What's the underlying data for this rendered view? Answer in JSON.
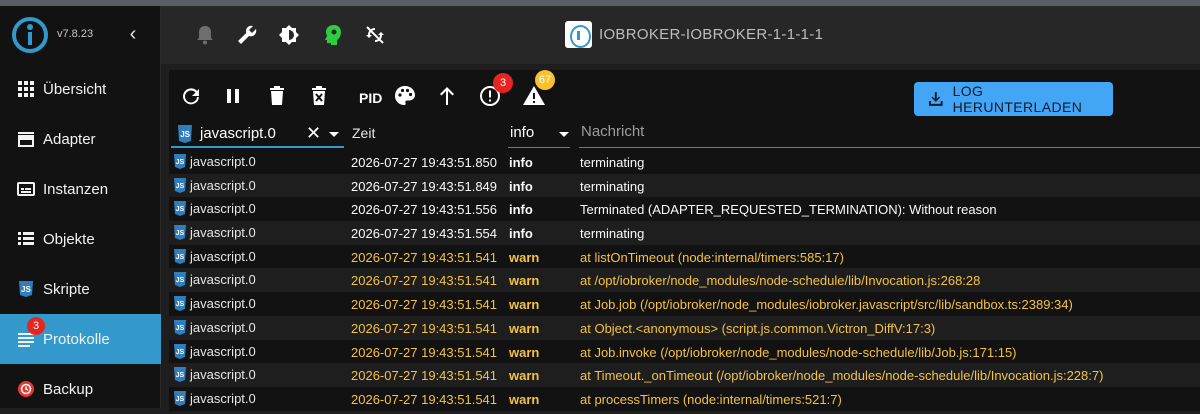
{
  "app": {
    "version": "v7.8.23",
    "host_name": "IOBROKER-IOBROKER-1-1-1-1"
  },
  "sidebar": {
    "items": [
      {
        "label": "Übersicht",
        "icon": "apps-grid-icon"
      },
      {
        "label": "Adapter",
        "icon": "store-icon"
      },
      {
        "label": "Instanzen",
        "icon": "instances-icon"
      },
      {
        "label": "Objekte",
        "icon": "list-icon"
      },
      {
        "label": "Skripte",
        "icon": "javascript-icon"
      },
      {
        "label": "Protokolle",
        "icon": "logs-icon",
        "badge": "3",
        "active": true
      },
      {
        "label": "Backup",
        "icon": "backup-icon"
      }
    ]
  },
  "appbar": {
    "icons": [
      "bell-icon",
      "wrench-icon",
      "brightness-icon",
      "expert-mode-icon",
      "sync-off-icon"
    ]
  },
  "toolbar": {
    "pid_label": "PID",
    "error_badge": "3",
    "warning_badge": "67",
    "download_label": "LOG HERUNTERLADEN"
  },
  "filter": {
    "source_value": "javascript.0",
    "time_header": "Zeit",
    "level_value": "info",
    "message_placeholder": "Nachricht"
  },
  "log_rows": [
    {
      "source": "javascript.0",
      "time": "2026-07-27 19:43:51.850",
      "level": "info",
      "message": "terminating"
    },
    {
      "source": "javascript.0",
      "time": "2026-07-27 19:43:51.849",
      "level": "info",
      "message": "terminating"
    },
    {
      "source": "javascript.0",
      "time": "2026-07-27 19:43:51.556",
      "level": "info",
      "message": "Terminated (ADAPTER_REQUESTED_TERMINATION): Without reason"
    },
    {
      "source": "javascript.0",
      "time": "2026-07-27 19:43:51.554",
      "level": "info",
      "message": "terminating"
    },
    {
      "source": "javascript.0",
      "time": "2026-07-27 19:43:51.541",
      "level": "warn",
      "message": "at listOnTimeout (node:internal/timers:585:17)"
    },
    {
      "source": "javascript.0",
      "time": "2026-07-27 19:43:51.541",
      "level": "warn",
      "message": "at /opt/iobroker/node_modules/node-schedule/lib/Invocation.js:268:28"
    },
    {
      "source": "javascript.0",
      "time": "2026-07-27 19:43:51.541",
      "level": "warn",
      "message": "at Job.job (/opt/iobroker/node_modules/iobroker.javascript/src/lib/sandbox.ts:2389:34)"
    },
    {
      "source": "javascript.0",
      "time": "2026-07-27 19:43:51.541",
      "level": "warn",
      "message": "at Object.<anonymous> (script.js.common.Victron_DiffV:17:3)"
    },
    {
      "source": "javascript.0",
      "time": "2026-07-27 19:43:51.541",
      "level": "warn",
      "message": "at Job.invoke (/opt/iobroker/node_modules/node-schedule/lib/Job.js:171:15)"
    },
    {
      "source": "javascript.0",
      "time": "2026-07-27 19:43:51.541",
      "level": "warn",
      "message": "at Timeout._onTimeout (/opt/iobroker/node_modules/node-schedule/lib/Invocation.js:228:7)"
    },
    {
      "source": "javascript.0",
      "time": "2026-07-27 19:43:51.541",
      "level": "warn",
      "message": "at processTimers (node:internal/timers:521:7)"
    }
  ],
  "colors": {
    "accent": "#3399cc",
    "warn": "#f5c242",
    "badge_red": "#e52521",
    "badge_yellow": "#fbc02d",
    "download": "#42a5f5"
  }
}
